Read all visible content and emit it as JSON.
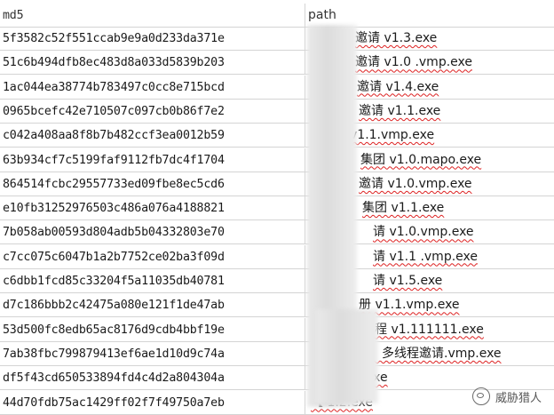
{
  "header": {
    "col1": "md5",
    "col2": "path"
  },
  "rows": [
    {
      "md5": "5f3582c52f551ccab9e9a0d233da371e",
      "path": "邀请 v1.3.exe"
    },
    {
      "md5": "51c6b494dfb8ec483d8a033d5839b203",
      "path": "邀请 v1.0  .vmp.exe"
    },
    {
      "md5": "1ac044ea38774b783497c0cc8e715bcd",
      "path": "邀请 v1.4.exe"
    },
    {
      "md5": "0965bcefc42e710507c097cb0b86f7e2",
      "path": "邀请 v1.1.exe"
    },
    {
      "md5": "c042a408aa8f8b7b482ccf3ea0012b59",
      "path": "v1.1.vmp.exe"
    },
    {
      "md5": "63b934cf7c5199faf9112fb7dc4f1704",
      "path": "集团 v1.0.mapo.exe"
    },
    {
      "md5": "864514fcbc29557733ed09fbe8ec5cd6",
      "path": "邀请 v1.0.vmp.exe"
    },
    {
      "md5": "e10fb31252976503c486a076a4188821",
      "path": "集团 v1.1.exe"
    },
    {
      "md5": "7b058ab00593d804adb5b04332803e70",
      "path": "请 v1.0.vmp.exe"
    },
    {
      "md5": "c7cc075c6047b1a2b7752ce02ba3f09d",
      "path": "请 v1.1  .vmp.exe"
    },
    {
      "md5": "c6dbb1fcd85c33204f5a11035db40781",
      "path": "请 v1.5.exe"
    },
    {
      "md5": "d7c186bbb2c42475a080e121f1de47ab",
      "path": "册 v1.1.vmp.exe"
    },
    {
      "md5": "53d500fc8edb65ac8176d9cdb4bbf19e",
      "path": "线程 v1.111111.exe"
    },
    {
      "md5": "7ab38fbc799879413ef6ae1d10d9c74a",
      "path": "】多线程邀请.vmp.exe"
    },
    {
      "md5": "df5f43cd650533894fd4c4d2a804304a",
      "path": ".1.exe"
    },
    {
      "md5": "44d70fdb75ac1429ff02f7f49750a7eb",
      "path": "【                  1.2.exe"
    }
  ],
  "path_offsets": [
    56,
    56,
    58,
    60,
    50,
    62,
    60,
    64,
    76,
    76,
    76,
    60,
    64,
    72,
    50,
    6
  ],
  "watermark": {
    "icon": "wechat-icon",
    "label": "威胁猎人"
  }
}
